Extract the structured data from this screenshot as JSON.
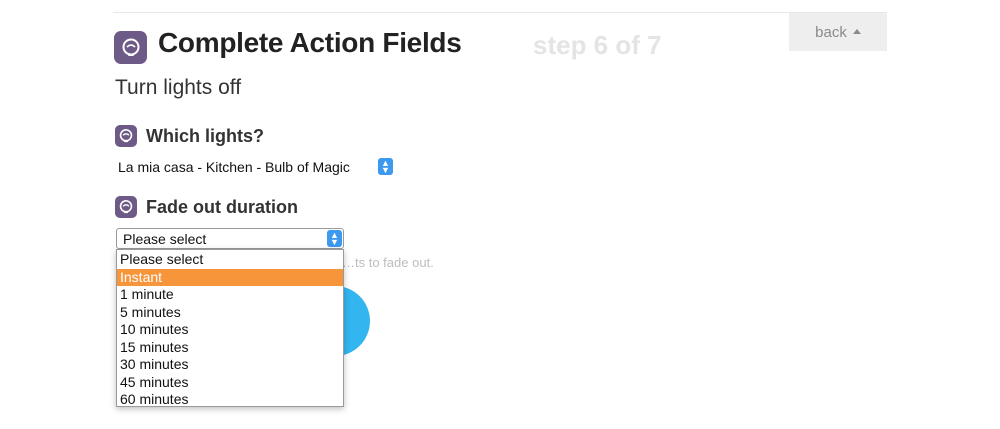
{
  "header": {
    "title": "Complete Action Fields",
    "step": "step 6 of 7",
    "back_label": "back",
    "icon": "hue-bulb-icon"
  },
  "action": {
    "name": "Turn lights off"
  },
  "fields": {
    "which_lights": {
      "label": "Which lights?",
      "value": "La mia casa - Kitchen - Bulb of Magic"
    },
    "fade_duration": {
      "label": "Fade out duration",
      "value": "Please select",
      "help_text": "…ts to fade out.",
      "options": [
        "Please select",
        "Instant",
        "1 minute",
        "5 minutes",
        "10 minutes",
        "15 minutes",
        "30 minutes",
        "45 minutes",
        "60 minutes"
      ],
      "highlighted_option": "Instant"
    }
  },
  "colors": {
    "icon_purple": "#6d5a86",
    "highlight_orange": "#f7953b",
    "submit_blue": "#33b6f0",
    "select_arrow_blue": "#3b99f0"
  }
}
